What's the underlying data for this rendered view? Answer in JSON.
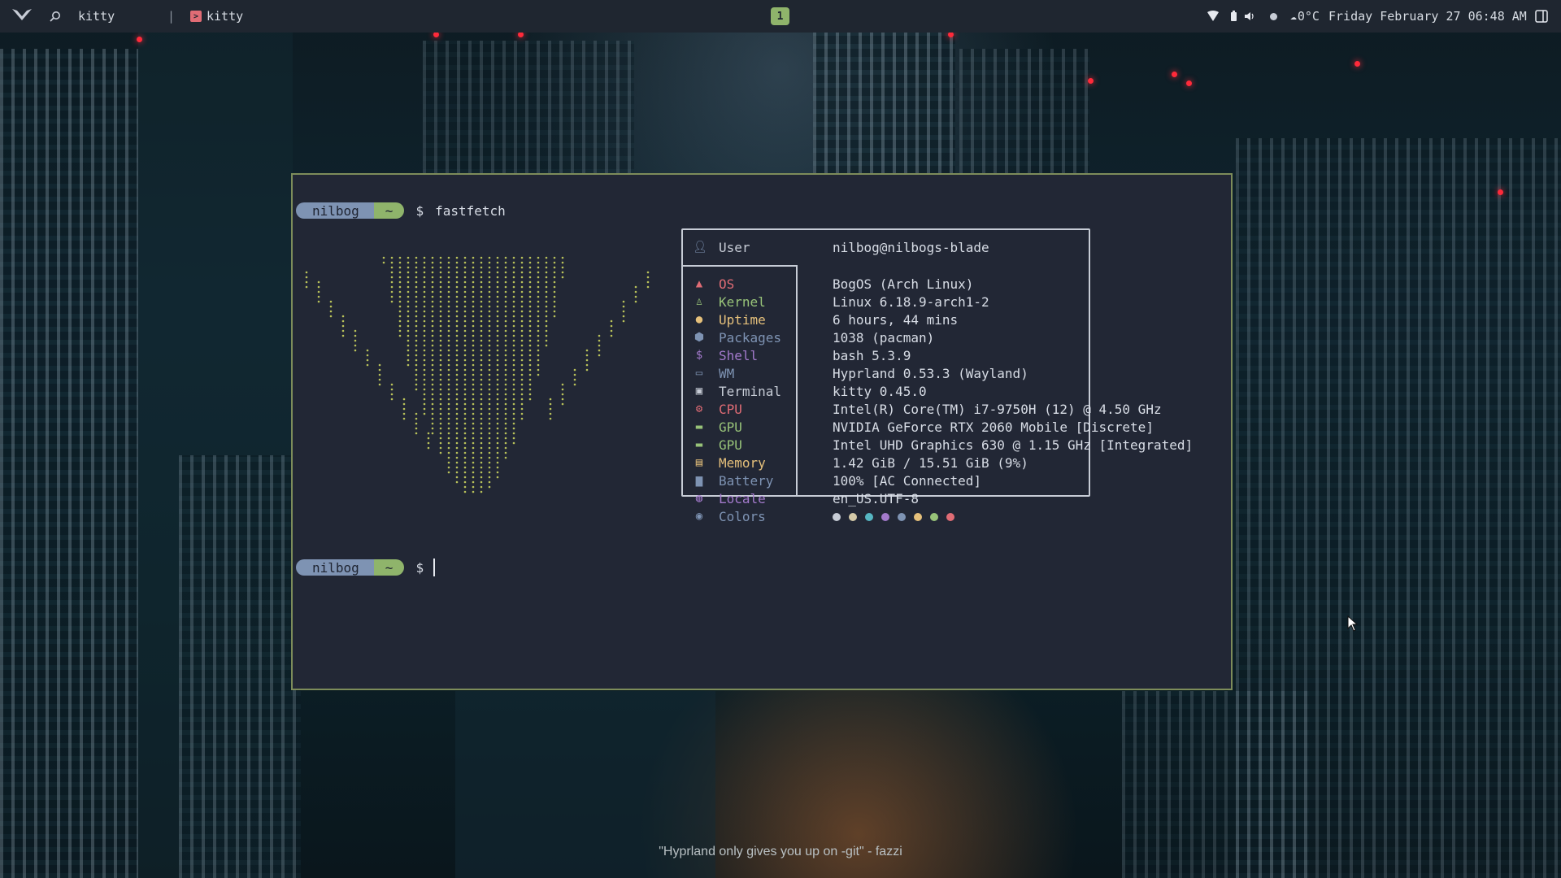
{
  "topbar": {
    "search_label": "kitty",
    "separator": "|",
    "active_window": "kitty",
    "workspace": "1",
    "weather": "0°C",
    "clock": "Friday February 27 06:48 AM"
  },
  "terminal": {
    "prompt": {
      "user": "nilbog",
      "dir": "~",
      "symbol": "$"
    },
    "command": "fastfetch",
    "info": {
      "user_key": "User",
      "user_value": "nilbog@nilbogs-blade",
      "rows": [
        {
          "icon": "arch-icon",
          "key": "OS",
          "value": "BogOS (Arch Linux)",
          "color": "#e06c75"
        },
        {
          "icon": "linux-icon",
          "key": "Kernel",
          "value": "Linux 6.18.9-arch1-2",
          "color": "#98c379"
        },
        {
          "icon": "clock-icon",
          "key": "Uptime",
          "value": "6 hours, 44 mins",
          "color": "#e5c07b"
        },
        {
          "icon": "package-icon",
          "key": "Packages",
          "value": "1038 (pacman)",
          "color": "#7e93b3"
        },
        {
          "icon": "shell-icon",
          "key": "Shell",
          "value": "bash 5.3.9",
          "color": "#a37acc"
        },
        {
          "icon": "window-icon",
          "key": "WM",
          "value": "Hyprland 0.53.3 (Wayland)",
          "color": "#7e93b3"
        },
        {
          "icon": "terminal-icon",
          "key": "Terminal",
          "value": "kitty 0.45.0",
          "color": "#c7ccd6"
        },
        {
          "icon": "cpu-icon",
          "key": "CPU",
          "value": "Intel(R) Core(TM) i7-9750H (12) @ 4.50 GHz",
          "color": "#e06c75"
        },
        {
          "icon": "gpu-icon",
          "key": "GPU",
          "value": "NVIDIA GeForce RTX 2060 Mobile [Discrete]",
          "color": "#98c379"
        },
        {
          "icon": "gpu-icon",
          "key": "GPU",
          "value": "Intel UHD Graphics 630 @ 1.15 GHz [Integrated]",
          "color": "#98c379"
        },
        {
          "icon": "memory-icon",
          "key": "Memory",
          "value": "1.42 GiB / 15.51 GiB (9%)",
          "color": "#e5c07b"
        },
        {
          "icon": "battery-icon",
          "key": "Battery",
          "value": "100% [AC Connected]",
          "color": "#7e93b3"
        },
        {
          "icon": "globe-icon",
          "key": "Locale",
          "value": "en_US.UTF-8",
          "color": "#a37acc"
        },
        {
          "icon": "palette-icon",
          "key": "Colors",
          "value": "",
          "color": "#7e93b3"
        }
      ],
      "palette": [
        "#c7ccd6",
        "#d4c9a8",
        "#56b6c2",
        "#a37acc",
        "#7e93b3",
        "#e5c07b",
        "#98c379",
        "#e06c75"
      ]
    }
  },
  "wallpaper": {
    "caption": "\"Hyprland only gives you up on -git\" - fazzi"
  }
}
